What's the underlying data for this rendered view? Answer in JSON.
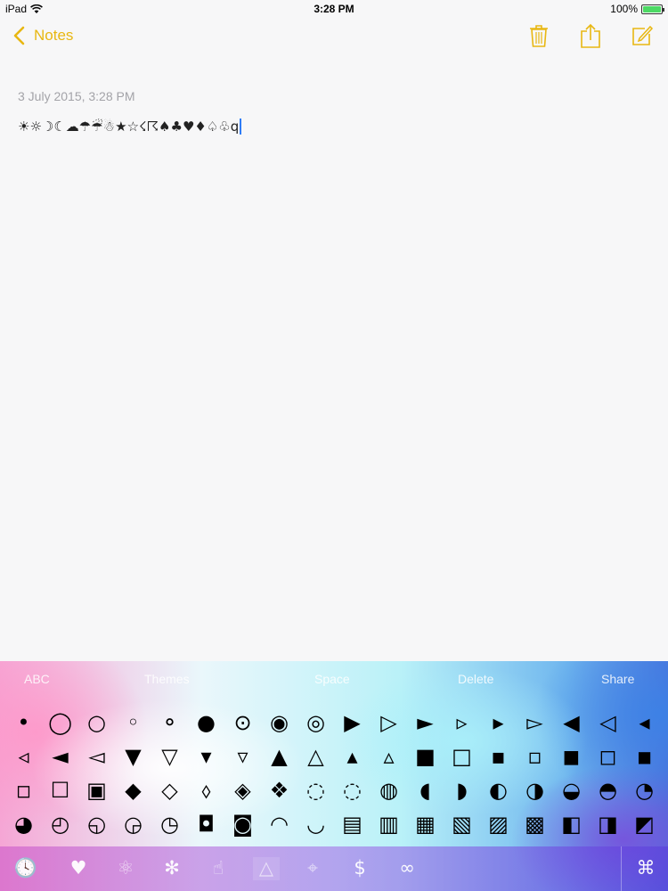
{
  "status": {
    "device": "iPad",
    "time": "3:28 PM",
    "battery": "100%",
    "battery_level": 1.0
  },
  "nav": {
    "back_label": "Notes",
    "icons": [
      "trash-icon",
      "share-icon",
      "compose-icon"
    ],
    "accent": "#e8b712"
  },
  "note": {
    "date": "3 July 2015, 3:28 PM",
    "text": "☀☼☽☾☁☂☔☃★☆☇☈♠♣♥♦♤♧q"
  },
  "keyboard": {
    "toolbar": {
      "abc": "ABC",
      "themes": "Themes",
      "space": "Space",
      "delete": "Delete",
      "share": "Share"
    },
    "rows": [
      [
        "•",
        "◯",
        "○",
        "◦",
        "⚬",
        "●",
        "⊙",
        "◉",
        "◎",
        "▶",
        "▷",
        "►",
        "▹",
        "▸",
        "▻",
        "◀",
        "◁",
        "◂"
      ],
      [
        "◃",
        "◄",
        "◅",
        "▼",
        "▽",
        "▾",
        "▿",
        "▲",
        "△",
        "▴",
        "▵",
        "■",
        "□",
        "▪",
        "▫",
        "◼",
        "◻",
        "◾"
      ],
      [
        "◽",
        "☐",
        "▣",
        "◆",
        "◇",
        "⬨",
        "◈",
        "❖",
        "◌",
        "◌",
        "◍",
        "◖",
        "◗",
        "◐",
        "◑",
        "◒",
        "◓",
        "◔"
      ],
      [
        "◕",
        "◴",
        "◵",
        "◶",
        "◷",
        "◘",
        "◙",
        "◠",
        "◡",
        "▤",
        "▥",
        "▦",
        "▧",
        "▨",
        "▩",
        "◧",
        "◨",
        "◩"
      ]
    ],
    "categories": [
      "🕓",
      "♥",
      "⚛",
      "✻",
      "☝",
      "△",
      "⌖",
      "$",
      "∞",
      "⌘"
    ]
  }
}
